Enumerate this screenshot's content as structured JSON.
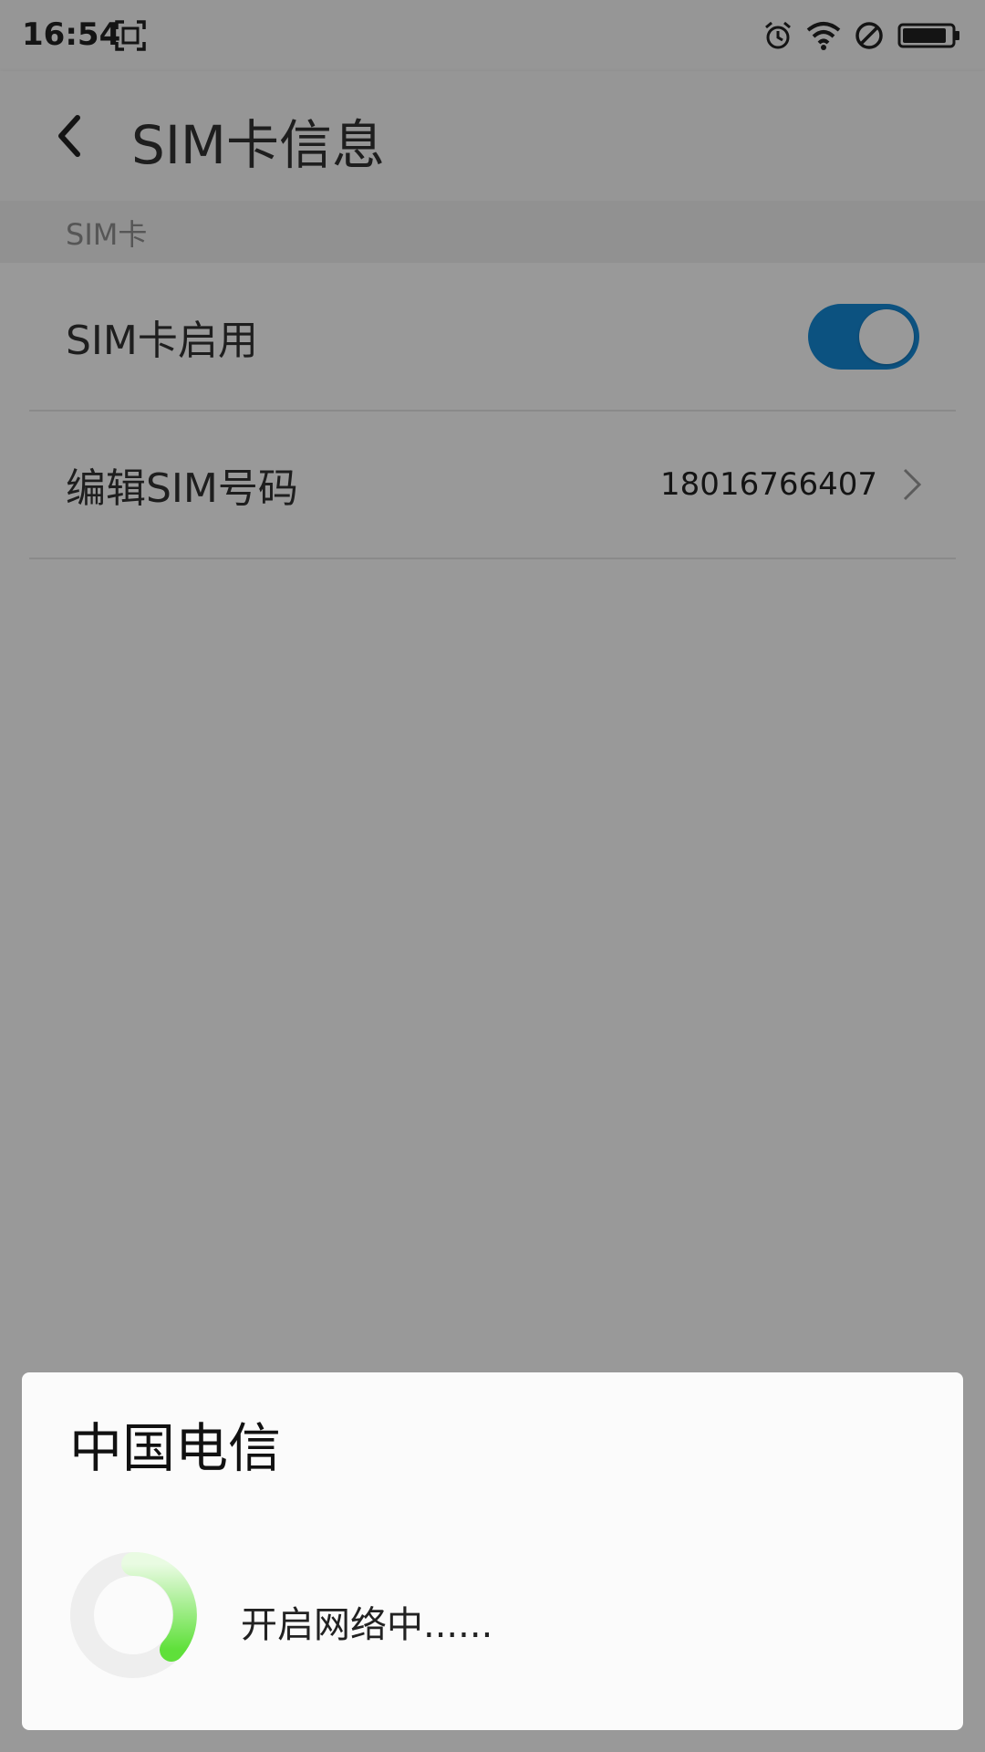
{
  "status_bar": {
    "time": "16:54",
    "icons": [
      "screenshot-icon",
      "alarm-icon",
      "wifi-icon",
      "do-not-disturb-icon",
      "battery-icon"
    ]
  },
  "header": {
    "back_icon": "chevron-left-icon",
    "title": "SIM卡信息"
  },
  "section": {
    "label": "SIM卡"
  },
  "rows": [
    {
      "label": "SIM卡启用",
      "control": "toggle",
      "toggle_on": true
    },
    {
      "label": "编辑SIM号码",
      "value": "18016766407",
      "trailing_icon": "chevron-right-icon"
    }
  ],
  "dialog": {
    "title": "中国电信",
    "message": "开启网络中......",
    "progress_icon": "loading-spinner-icon"
  },
  "colors": {
    "toggle_on": "#1589d6",
    "spinner_track": "#eeeeee",
    "spinner_accent": "#5fe03a",
    "scrim": "rgba(0,0,0,0.40)"
  }
}
